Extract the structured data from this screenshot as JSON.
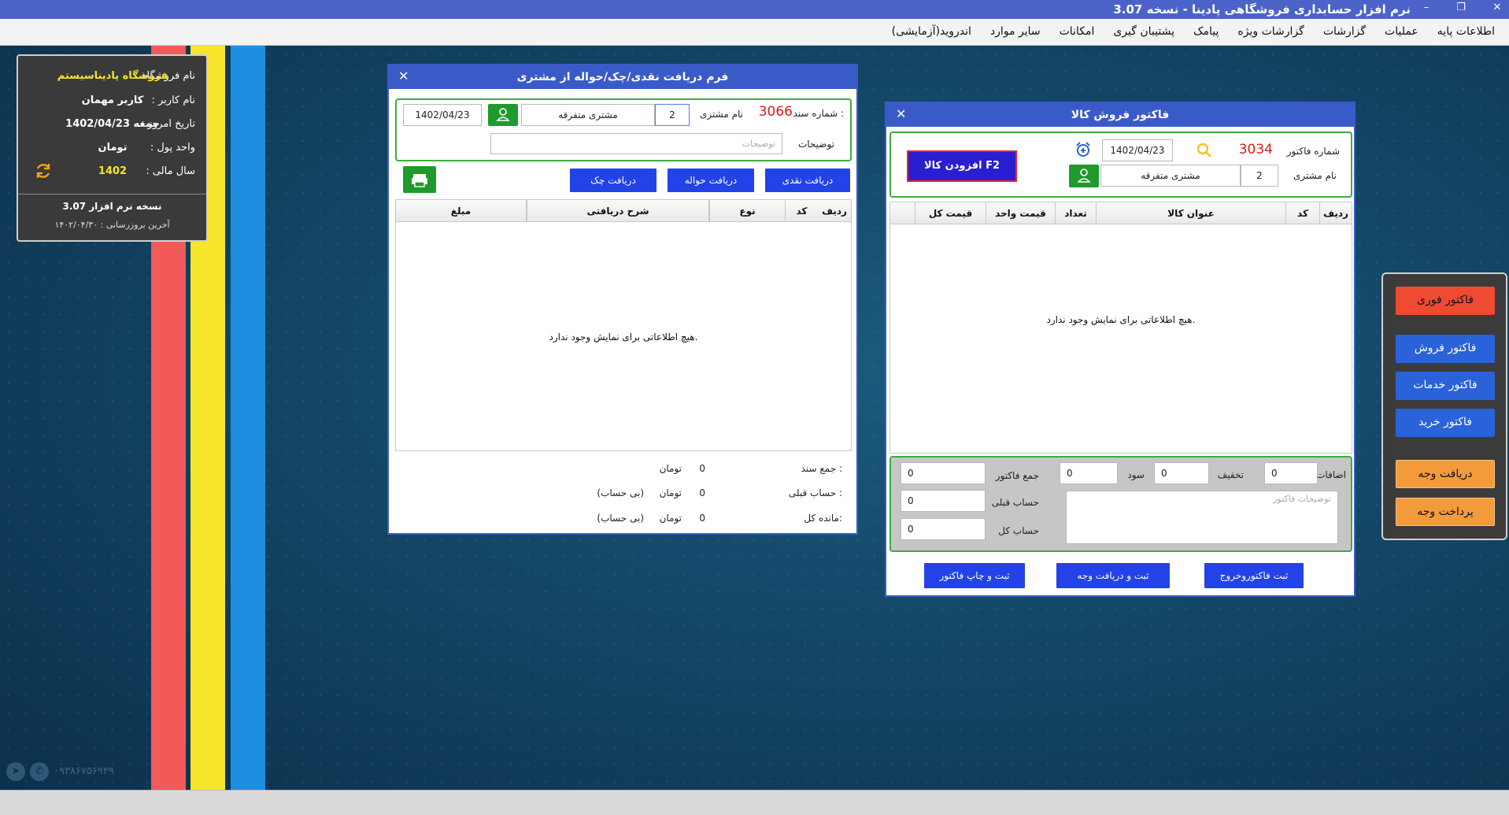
{
  "titlebar": {
    "title": "نرم افزار حسابداری فروشگاهی پادینا - نسخه 3.07"
  },
  "menu": {
    "items": [
      "اطلاعات پایه",
      "عملیات",
      "گزارشات",
      "گزارشات ویژه",
      "پیامک",
      "پشتیبان گیری",
      "امکانات",
      "سایر موارد",
      "اندروید(آزمایشی)"
    ]
  },
  "colors": {
    "stripe_red": "#f25a5a",
    "stripe_yellow": "#f6e52a",
    "stripe_blue": "#1e8ee0",
    "accent_blue": "#3a5bc7",
    "frame_green": "#3cae3c"
  },
  "info": {
    "store_label": "نام فروشگاه :",
    "store_value": "فروشگاه پادیناسیستم",
    "user_label": "نام کاربر :",
    "user_value": "کاربر مهمان",
    "date_label": "تاریخ امروز :",
    "date_value": "جمعه 1402/04/23",
    "currency_label": "واحد پول :",
    "currency_value": "تومان",
    "fiscal_label": "سال مالی :",
    "fiscal_value": "1402",
    "version": "نسخه نرم افزار 3.07",
    "last_update": "آخرین بروزرسانی : ۱۴۰۲/۰۴/۳۰"
  },
  "receive_form": {
    "title": "فرم دریافت نقدی/چک/حواله از مشتری",
    "doc_number_label": "شماره سند :",
    "doc_number": "3066",
    "customer_label": "نام مشتری",
    "customer_code": "2",
    "customer_name": "مشتری متفرقه",
    "date": "1402/04/23",
    "notes_label": "توضیحات",
    "notes_placeholder": "توضیحات",
    "btn_cash": "دریافت نقدی",
    "btn_transfer": "دریافت حواله",
    "btn_check": "دریافت چک",
    "columns": [
      "ردیف",
      "کد",
      "نوع",
      "شرح دریافتی",
      "مبلغ"
    ],
    "empty_text": "هیچ اطلاعاتی برای نمایش وجود ندارد.",
    "total_label": "جمع سند :",
    "total_value": "0",
    "total_unit": "تومان",
    "prev_label": "حساب قبلی :",
    "prev_value": "0",
    "prev_unit": "تومان",
    "prev_note": "(بی حساب)",
    "balance_label": "مانده کل:",
    "balance_value": "0",
    "balance_unit": "تومان",
    "balance_note": "(بی حساب)"
  },
  "invoice_form": {
    "title": "فاکتور فروش کالا",
    "invoice_number_label": "شماره فاکتور",
    "invoice_number": "3034",
    "date": "1402/04/23",
    "customer_label": "نام مشتری",
    "customer_code": "2",
    "customer_name": "مشتری متفرقه",
    "add_item_btn": "افزودن کالا F2",
    "columns": [
      "ردیف",
      "کد",
      "عنوان کالا",
      "تعداد",
      "قیمت واحد",
      "قیمت کل"
    ],
    "empty_text": "هیچ اطلاعاتی برای نمایش وجود ندارد.",
    "additions_label": "اضافات",
    "additions_value": "0",
    "discount_label": "تخفیف",
    "discount_value": "0",
    "profit_label": "سود",
    "profit_value": "0",
    "invoice_total_label": "جمع فاکتور",
    "invoice_total_value": "0",
    "prev_account_label": "حساب قبلی",
    "prev_account_value": "0",
    "total_account_label": "حساب کل",
    "total_account_value": "0",
    "notes_placeholder": "توضیحات فاکتور",
    "btn_save_exit": "ثبت فاکتوروخروج",
    "btn_save_receive": "ثبت و دریافت وجه",
    "btn_save_print": "ثبت و چاپ فاکتور"
  },
  "side_panel": {
    "quick_invoice": "فاکتور فوری",
    "sales_invoice": "فاکتور فروش",
    "service_invoice": "فاکتور خدمات",
    "purchase_invoice": "فاکتور خرید",
    "receive_payment": "دریافت وجه",
    "make_payment": "پرداخت وجه"
  },
  "watermark": {
    "phone": "۰۹۳۸۶۷۵۶۹۲۹"
  }
}
